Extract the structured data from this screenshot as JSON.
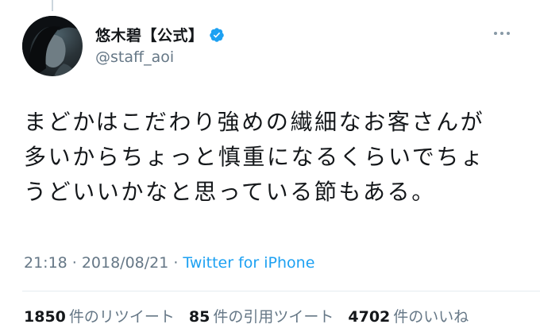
{
  "user": {
    "display_name": "悠木碧【公式】",
    "handle": "@staff_aoi",
    "verified": true
  },
  "tweet": {
    "lines": [
      "まどかはこだわり強めの繊細なお客さんが",
      "多いからちょっと慎重になるくらいでちょ",
      "うどいいかなと思っている節もある。"
    ],
    "time": "21:18",
    "date": "2018/08/21",
    "separator": "·",
    "source": "Twitter for iPhone"
  },
  "stats": {
    "retweets": {
      "count": "1850",
      "label": "件のリツイート"
    },
    "quotes": {
      "count": "85",
      "label": "件の引用ツイート"
    },
    "likes": {
      "count": "4702",
      "label": "件のいいね"
    }
  },
  "icons": {
    "verified": "verified-badge-icon",
    "more": "more-options-icon"
  },
  "colors": {
    "accent": "#1da1f2",
    "text": "#14171a",
    "secondary": "#657786"
  }
}
